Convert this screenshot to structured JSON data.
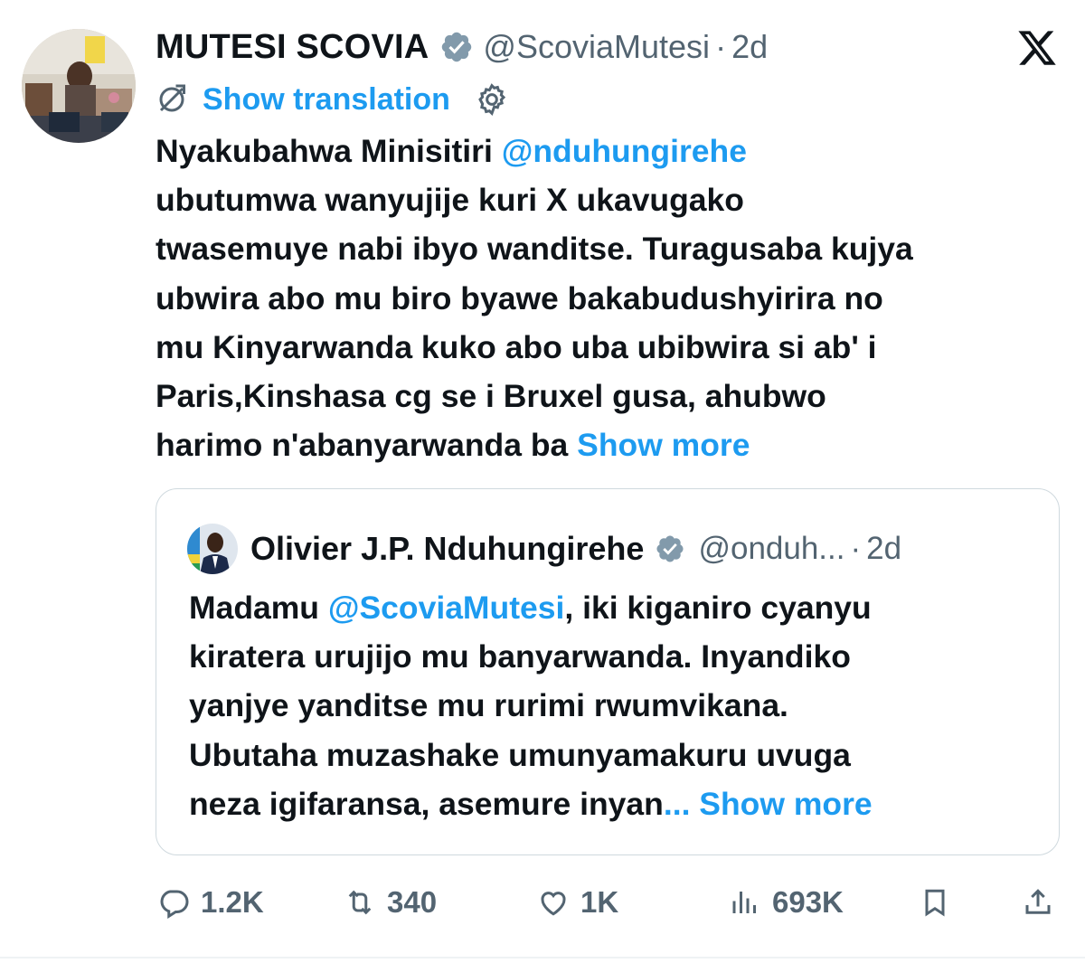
{
  "tweet": {
    "author_name": "MUTESI SCOVIA",
    "author_handle": "@ScoviaMutesi",
    "separator": "·",
    "time": "2d",
    "translate_label": "Show translation",
    "body_lines": [
      [
        {
          "text": "Nyakubahwa Minisitiri "
        },
        {
          "text": "@nduhungirehe",
          "link": true
        }
      ],
      [
        {
          "text": "ubutumwa wanyujije kuri X ukavugako"
        }
      ],
      [
        {
          "text": "twasemuye nabi ibyo wanditse. Turagusaba kujya"
        }
      ],
      [
        {
          "text": "ubwira abo mu biro byawe bakabudushyirira no"
        }
      ],
      [
        {
          "text": "mu Kinyarwanda kuko abo uba ubibwira si ab' i"
        }
      ],
      [
        {
          "text": "Paris,Kinshasa cg se i Bruxel gusa, ahubwo"
        }
      ],
      [
        {
          "text": "harimo n'abanyarwanda ba "
        },
        {
          "text": "Show more",
          "link": true
        }
      ]
    ]
  },
  "quoted": {
    "author_name": "Olivier J.P. Nduhungirehe",
    "author_handle": "@onduh...",
    "separator": "·",
    "time": "2d",
    "body_lines": [
      [
        {
          "text": "Madamu "
        },
        {
          "text": "@ScoviaMutesi",
          "link": true
        },
        {
          "text": ", iki kiganiro cyanyu"
        }
      ],
      [
        {
          "text": "kiratera urujijo mu banyarwanda. Inyandiko"
        }
      ],
      [
        {
          "text": "yanjye yanditse mu rurimi rwumvikana."
        }
      ],
      [
        {
          "text": "Ubutaha muzashake umunyamakuru uvuga"
        }
      ],
      [
        {
          "text": "neza igifaransa, asemure inyan"
        },
        {
          "text": "... Show more",
          "link": true
        }
      ]
    ]
  },
  "actions": {
    "reply_count": "1.2K",
    "retweet_count": "340",
    "like_count": "1K",
    "views_count": "693K"
  },
  "icons": {
    "verified": "verified-badge-icon",
    "x_logo": "x-logo-icon",
    "translate": "globe-icon",
    "settings": "gear-icon",
    "reply": "reply-icon",
    "retweet": "retweet-icon",
    "like": "heart-icon",
    "views": "views-icon",
    "bookmark": "bookmark-icon",
    "share": "share-icon"
  },
  "colors": {
    "accent": "#1d9bf0",
    "text": "#0f1419",
    "muted": "#536471",
    "border": "#cfd9de",
    "verified_badge": "#829aab"
  }
}
